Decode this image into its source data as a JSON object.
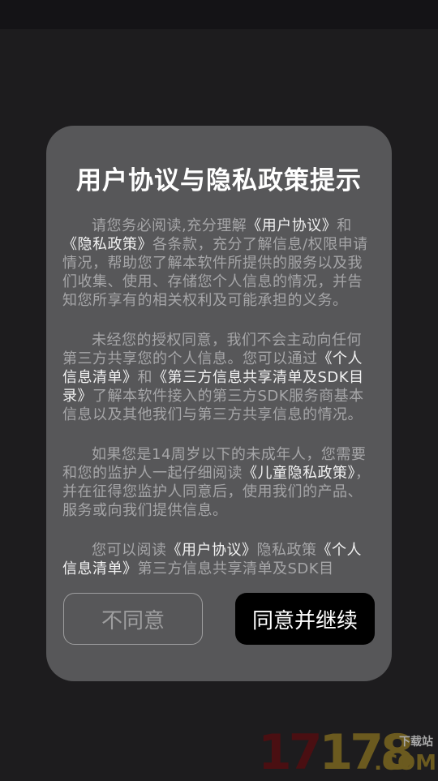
{
  "dialog": {
    "title": "用户协议与隐私政策提示",
    "p1": {
      "t1": "请您务必阅读,充分理解",
      "l1": "《用户协议》",
      "t2": "和",
      "l2": "《隐私政策》",
      "t3": "各条款，充分了解信息/权限申请情况，帮助您了解本软件所提供的服务以及我们收集、使用、存储您个人信息的情况，并告知您所享有的相关权利及可能承担的义务。"
    },
    "p2": {
      "t1": "未经您的授权同意，我们不会主动向任何第三方共享您的个人信息。您可以通过",
      "l1": "《个人信息清单》",
      "t2": "和",
      "l2": "《第三方信息共享清单及SDK目录》",
      "t3": "了解本软件接入的第三方SDK服务商基本信息以及其他我们与第三方共享信息的情况。"
    },
    "p3": {
      "t1": "如果您是14周岁以下的未成年人，您需要和您的监护人一起仔细阅读",
      "l1": "《儿童隐私政策》",
      "t2": "，并在征得您监护人同意后，使用我们的产品、服务或向我们提供信息。"
    },
    "p4": {
      "t1": "您可以阅读",
      "l1": "《用户协议》",
      "t2": "隐私政策",
      "l2": "《个人信息清单》",
      "t3": "第三方信息共享清单及SDK目"
    },
    "disagree_label": "不同意",
    "agree_label": "同意并继续"
  },
  "watermark": {
    "num_a": "17",
    "num_b": "178",
    "download": "下载站",
    "com": ".COM"
  }
}
